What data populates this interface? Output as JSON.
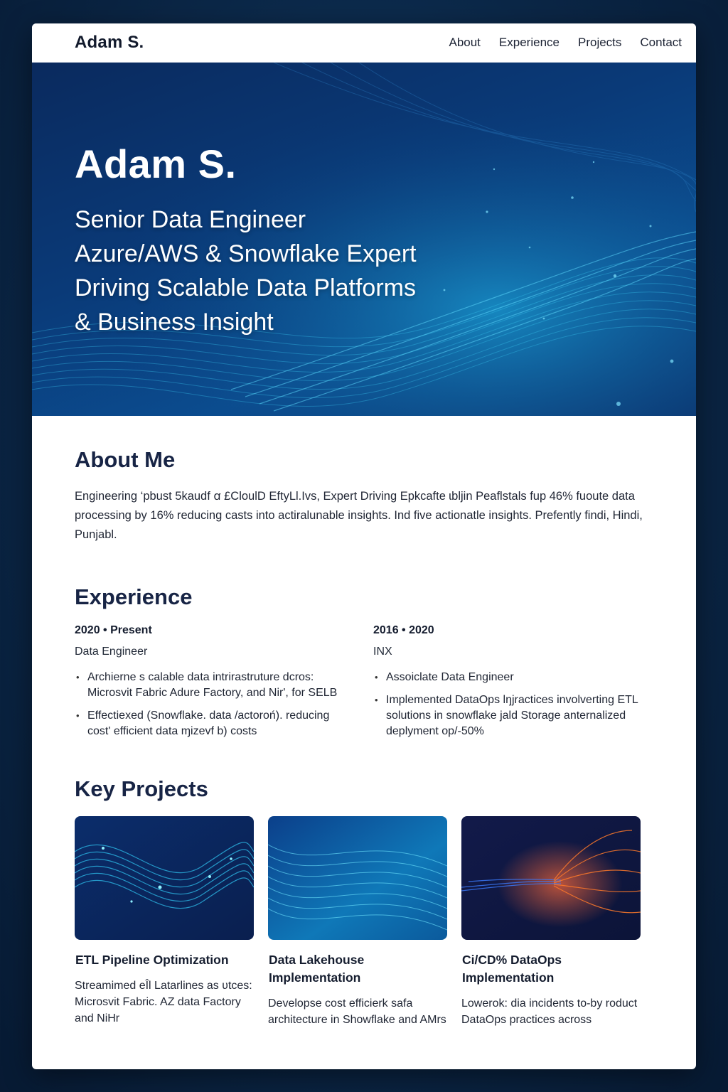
{
  "header": {
    "brand": "Adam S.",
    "nav": [
      "About",
      "Experience",
      "Projects",
      "Contact"
    ]
  },
  "hero": {
    "name": "Adam S.",
    "lines": [
      "Senior Data Engineer",
      "Azure/AWS & Snowflake Expert",
      "Driving Scalable Data Platforms",
      "& Business Insight"
    ]
  },
  "about": {
    "title": "About Me",
    "text": "Engineering ‘pbust 5kaudf ꭤ £CloulD EftyLl.Ivs, Expert Driving Epkcafte ɩbljin Peaflstals fup 46% fuoute data processing by 16% reducing casts into actiralunable insights. Ind five actionatle insights. Prefently findi, Hindi, Punjabl."
  },
  "experience": {
    "title": "Experience",
    "jobs": [
      {
        "date": "2020 • Present",
        "role": "Data Engineer",
        "bullets": [
          "Archierne s calable data intrirastruture dcros: Microsvit Fabric Adure Factory, and Nir', for SELB",
          "Effectiexed (Snowflake. data /actoroń). reducing cost' efficient data ɱizevf b) costs"
        ]
      },
      {
        "date": "2016 • 2020",
        "role": "INX",
        "bullets": [
          "Assoiclate Data Engineer",
          "Implemented DataOps lŋjractices involverting ETL solutions in snowflake jald Storage anternalized deplyment op/-50%"
        ]
      }
    ]
  },
  "projects": {
    "title": "Key Projects",
    "items": [
      {
        "title": "ETL Pipeline Optimization",
        "desc": "Streamimed eÎl Latarlines as ʋtces: Microsvit Fabric. AZ data Factory and NiHr"
      },
      {
        "title": "Data Lakehouse Implementation",
        "desc": "Developse cost efficierk safa architecture in Showflake and AMrs"
      },
      {
        "title": "Ci/CD% DataOps Implementation",
        "desc": "Lowerok: dia incidents to-by roduct DataOps practices across"
      }
    ]
  },
  "colors": {
    "page_bg": "#0b2747",
    "hero_bg": "#0a3a78",
    "heading": "#172445",
    "accent_cyan": "#2ad4f0",
    "accent_orange": "#ff7a2a"
  }
}
